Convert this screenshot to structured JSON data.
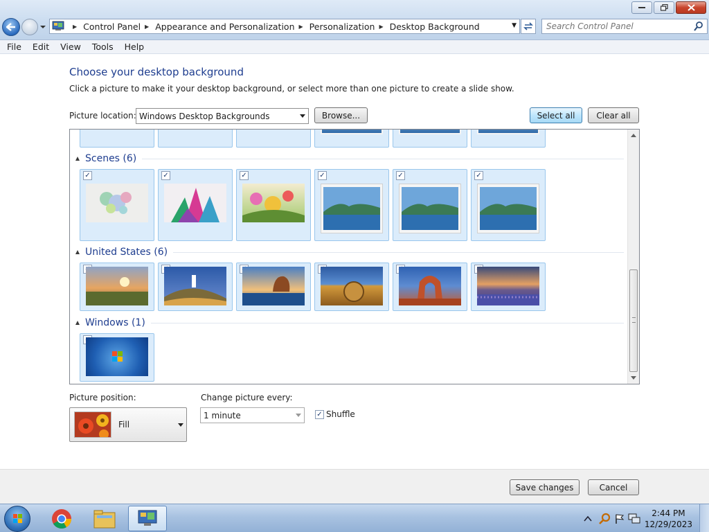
{
  "window": {
    "address": {
      "crumbs": [
        "Control Panel",
        "Appearance and Personalization",
        "Personalization",
        "Desktop Background"
      ]
    },
    "search_placeholder": "Search Control Panel"
  },
  "menu": [
    "File",
    "Edit",
    "View",
    "Tools",
    "Help"
  ],
  "page": {
    "heading": "Choose your desktop background",
    "subtext": "Click a picture to make it your desktop background, or select more than one picture to create a slide show.",
    "location_label": "Picture location:",
    "location_value": "Windows Desktop Backgrounds",
    "browse_label": "Browse...",
    "select_all_label": "Select all",
    "clear_all_label": "Clear all"
  },
  "gallery": {
    "groups": [
      {
        "name": "Scenes (6)"
      },
      {
        "name": "United States (6)"
      },
      {
        "name": "Windows (1)"
      }
    ],
    "checked_mark": "✓"
  },
  "options": {
    "position_label": "Picture position:",
    "position_value": "Fill",
    "change_label": "Change picture every:",
    "change_value": "1 minute",
    "shuffle_label": "Shuffle",
    "shuffle_checked": true
  },
  "footer": {
    "save_label": "Save changes",
    "cancel_label": "Cancel"
  },
  "taskbar": {
    "time": "2:44 PM",
    "date": "12/29/2023"
  }
}
